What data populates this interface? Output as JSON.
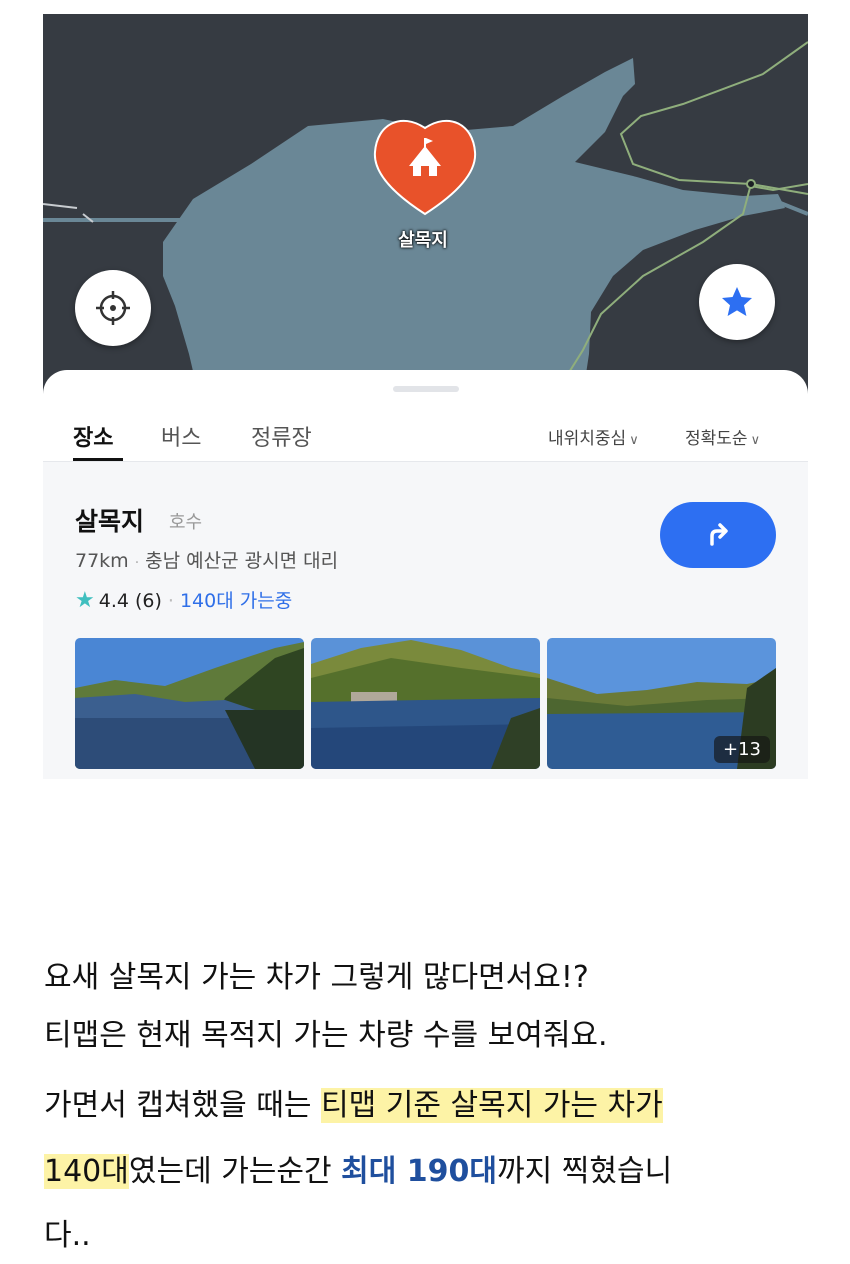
{
  "map": {
    "pin_label": "살목지",
    "buttons": {
      "locate_icon": "crosshair-icon",
      "favorite_icon": "star-icon"
    },
    "colors": {
      "background": "#363b42",
      "lake": "#6a8796",
      "road": "#8fae7c",
      "pin": "#e8522a"
    }
  },
  "tabs": [
    {
      "label": "장소",
      "active": true
    },
    {
      "label": "버스",
      "active": false
    },
    {
      "label": "정류장",
      "active": false
    }
  ],
  "sort": {
    "distance_label": "내위치중심",
    "accuracy_label": "정확도순"
  },
  "result": {
    "name": "살목지",
    "category": "호수",
    "distance": "77km",
    "address": "충남 예산군 광시면 대리",
    "rating": "4.4",
    "review_count": "(6)",
    "going_text": "140대 가는중",
    "route_icon": "turn-right-arrow-icon",
    "more_photos": "+13",
    "accent_color": "#2d6ff2"
  },
  "caption": {
    "line1": "요새 살목지 가는 차가 그렇게 많다면서요!?",
    "line2": "티맵은 현재 목적지 가는 차량 수를 보여줘요.",
    "line3_plain": "가면서 캡쳐했을 때는 ",
    "line3_highlight": "티맵 기준 살목지 가는 차가",
    "line4_highlight": "140대",
    "line4_mid": "였는데 가는순간 ",
    "line4_emphasis": "최대 190대",
    "line4_end": "까지 찍혔습니",
    "line5": "다..",
    "highlight_color": "#fdf3a6",
    "emphasis_color": "#1f4f9e"
  }
}
